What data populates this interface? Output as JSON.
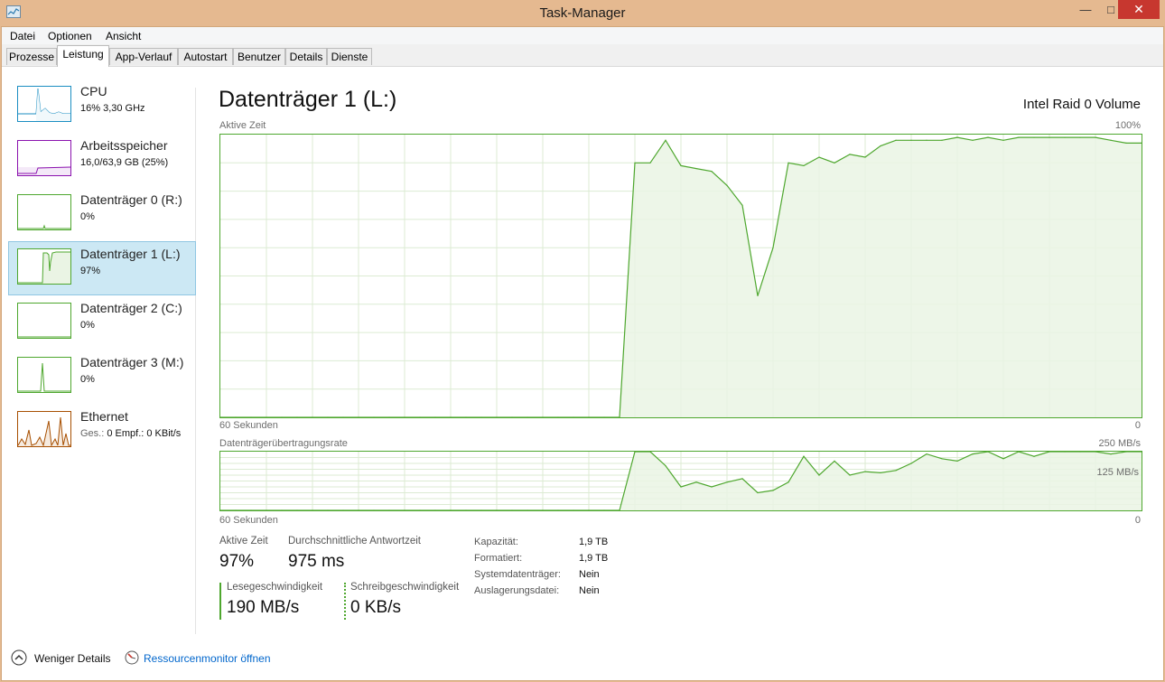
{
  "window": {
    "title": "Task-Manager"
  },
  "menu": [
    "Datei",
    "Optionen",
    "Ansicht"
  ],
  "tabs": [
    "Prozesse",
    "Leistung",
    "App-Verlauf",
    "Autostart",
    "Benutzer",
    "Details",
    "Dienste"
  ],
  "active_tab": "Leistung",
  "sidebar": {
    "items": [
      {
        "name": "CPU",
        "sub": "16% 3,30 GHz",
        "color": "#1b8ec2"
      },
      {
        "name": "Arbeitsspeicher",
        "sub": "16,0/63,9 GB (25%)",
        "color": "#8b12ae"
      },
      {
        "name": "Datenträger 0 (R:)",
        "sub": "0%",
        "color": "#4ea72e"
      },
      {
        "name": "Datenträger 1 (L:)",
        "sub": "97%",
        "color": "#4ea72e",
        "selected": true
      },
      {
        "name": "Datenträger 2 (C:)",
        "sub": "0%",
        "color": "#4ea72e"
      },
      {
        "name": "Datenträger 3 (M:)",
        "sub": "0%",
        "color": "#4ea72e"
      },
      {
        "name": "Ethernet",
        "sub_label": "Ges.:",
        "sub_rest": "0 Empf.: 0 KBit/s",
        "color": "#a74f01"
      }
    ]
  },
  "main": {
    "title": "Datenträger 1 (L:)",
    "device": "Intel Raid 0 Volume",
    "active_chart": {
      "label": "Aktive Zeit",
      "max_label": "100%",
      "x_label": "60 Sekunden",
      "min_label": "0"
    },
    "transfer_chart": {
      "label": "Datenträgerübertragungsrate",
      "max_label": "250 MB/s",
      "mid_label": "125 MB/s",
      "x_label": "60 Sekunden",
      "min_label": "0"
    },
    "stats": {
      "active_time_label": "Aktive Zeit",
      "active_time_value": "97%",
      "avg_response_label": "Durchschnittliche Antwortzeit",
      "avg_response_value": "975 ms",
      "read_label": "Lesegeschwindigkeit",
      "read_value": "190 MB/s",
      "write_label": "Schreibgeschwindigkeit",
      "write_value": "0 KB/s"
    },
    "properties": [
      {
        "label": "Kapazität:",
        "value": "1,9 TB"
      },
      {
        "label": "Formatiert:",
        "value": "1,9 TB"
      },
      {
        "label": "Systemdatenträger:",
        "value": "Nein"
      },
      {
        "label": "Auslagerungsdatei:",
        "value": "Nein"
      }
    ]
  },
  "footer": {
    "fewer_details": "Weniger Details",
    "resource_monitor": "Ressourcenmonitor öffnen"
  },
  "colors": {
    "disk_line": "#4ea72e",
    "disk_fill": "#eaf4e4",
    "grid": "#dcebd3",
    "link": "#0066cc",
    "title_bar": "#e5b990",
    "close": "#c7372f"
  },
  "chart_data": [
    {
      "type": "area",
      "title": "Aktive Zeit",
      "xlabel": "60 Sekunden",
      "ylim": [
        0,
        100
      ],
      "x": [
        60,
        59,
        58,
        57,
        56,
        55,
        54,
        53,
        52,
        51,
        50,
        49,
        48,
        47,
        46,
        45,
        44,
        43,
        42,
        41,
        40,
        39,
        38,
        37,
        36,
        35,
        34,
        33,
        32,
        31,
        30,
        29,
        28,
        27,
        26,
        25,
        24,
        23,
        22,
        21,
        20,
        19,
        18,
        17,
        16,
        15,
        14,
        13,
        12,
        11,
        10,
        9,
        8,
        7,
        6,
        5,
        4,
        3,
        2,
        1,
        0
      ],
      "series": [
        {
          "values": [
            0,
            0,
            0,
            0,
            0,
            0,
            0,
            0,
            0,
            0,
            0,
            0,
            0,
            0,
            0,
            0,
            0,
            0,
            0,
            0,
            0,
            0,
            0,
            0,
            0,
            0,
            0,
            90,
            90,
            98,
            89,
            88,
            87,
            82,
            75,
            43,
            60,
            90,
            89,
            92,
            90,
            93,
            92,
            96,
            98,
            98,
            98,
            98,
            99,
            98,
            99,
            98,
            99,
            99,
            99,
            99,
            99,
            99,
            98,
            97,
            97
          ]
        }
      ]
    },
    {
      "type": "area",
      "title": "Datenträgerübertragungsrate",
      "xlabel": "60 Sekunden",
      "ylim": [
        0,
        250
      ],
      "x": [
        60,
        59,
        58,
        57,
        56,
        55,
        54,
        53,
        52,
        51,
        50,
        49,
        48,
        47,
        46,
        45,
        44,
        43,
        42,
        41,
        40,
        39,
        38,
        37,
        36,
        35,
        34,
        33,
        32,
        31,
        30,
        29,
        28,
        27,
        26,
        25,
        24,
        23,
        22,
        21,
        20,
        19,
        18,
        17,
        16,
        15,
        14,
        13,
        12,
        11,
        10,
        9,
        8,
        7,
        6,
        5,
        4,
        3,
        2,
        1,
        0
      ],
      "series": [
        {
          "values": [
            0,
            0,
            0,
            0,
            0,
            0,
            0,
            0,
            0,
            0,
            0,
            0,
            0,
            0,
            0,
            0,
            0,
            0,
            0,
            0,
            0,
            0,
            0,
            0,
            0,
            0,
            0,
            250,
            250,
            190,
            100,
            120,
            100,
            120,
            135,
            75,
            85,
            120,
            230,
            150,
            210,
            150,
            165,
            160,
            170,
            200,
            240,
            220,
            210,
            240,
            270,
            220,
            270,
            230,
            260,
            250,
            250,
            260,
            240,
            250,
            250
          ]
        }
      ]
    }
  ]
}
